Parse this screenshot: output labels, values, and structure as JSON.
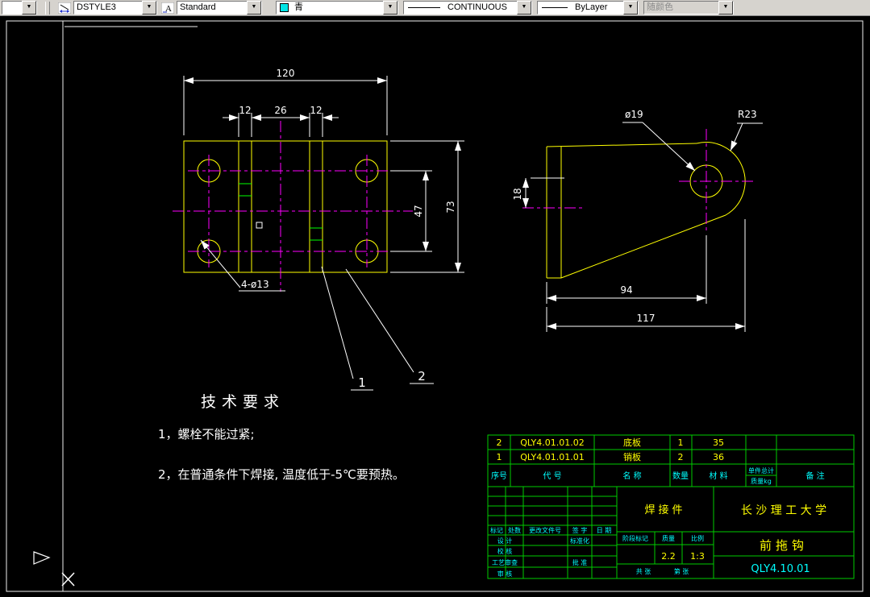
{
  "colors": {
    "geometry": "#ffff00",
    "centerline": "#ff00ff",
    "dimension": "#ffffff",
    "frame": "#f0f0f0",
    "weld_marks": "#00ff00",
    "table_lines": "#00cc00",
    "table_text_primary": "#ffff00",
    "table_text_secondary": "#00ffff",
    "toolbar_bg": "#d6d3ce",
    "color_swatch": "#00e5e5"
  },
  "toolbar": {
    "mini_combo_value": "",
    "dimstyle_combo": "DSTYLE3",
    "textstyle_combo": "Standard",
    "color_combo": "青",
    "linetype_combo": "CONTINUOUS",
    "lineweight_combo": "ByLayer",
    "plotstyle_combo": "随颜色"
  },
  "views": {
    "left": {
      "dim_width": "120",
      "dim_rib_left": "12",
      "dim_rib_gap": "26",
      "dim_rib_right": "12",
      "dim_hole_spacing": "47",
      "dim_height": "73",
      "holes_note": "4-ø13",
      "balloon_1": "1",
      "balloon_2": "2"
    },
    "right": {
      "dim_hole_dia": "ø19",
      "dim_radius": "R23",
      "dim_left_height": "18",
      "dim_hole_dist": "94",
      "dim_total": "117"
    }
  },
  "tech_requirements": {
    "title": "技术要求",
    "item1": "1，螺栓不能过紧;",
    "item2": "2，在普通条件下焊接, 温度低于-5℃要预热。"
  },
  "titleblock": {
    "parts": [
      {
        "seq": "2",
        "code": "QLY4.01.01.02",
        "name": "底板",
        "qty": "1",
        "material": "35"
      },
      {
        "seq": "1",
        "code": "QLY4.01.01.01",
        "name": "销板",
        "qty": "2",
        "material": "36"
      }
    ],
    "header": {
      "seq": "序号",
      "code": "代    号",
      "name": "名    称",
      "qty": "数量",
      "material": "材    料",
      "weight1": "单件总计",
      "weight2": "质量kg",
      "remark": "备    注"
    },
    "assembly": "焊接件",
    "organization": "长 沙 理 工 大 学",
    "part_name": "前拖钩",
    "drawing_no": "QLY4.10.01",
    "weight_value": "2.2",
    "scale_value": "1:3",
    "labels": {
      "mark": "标记",
      "count": "处数",
      "change_doc": "更改文件号",
      "sign": "签 字",
      "date": "日 期",
      "design": "设 计",
      "check": "校 核",
      "process": "工艺审查",
      "audit": "审 核",
      "standard": "标准化",
      "approve": "批 准",
      "stage": "阶段标记",
      "weight": "质量",
      "scale": "比例",
      "sheets": "共  张",
      "sheet_no": "第  张"
    }
  }
}
